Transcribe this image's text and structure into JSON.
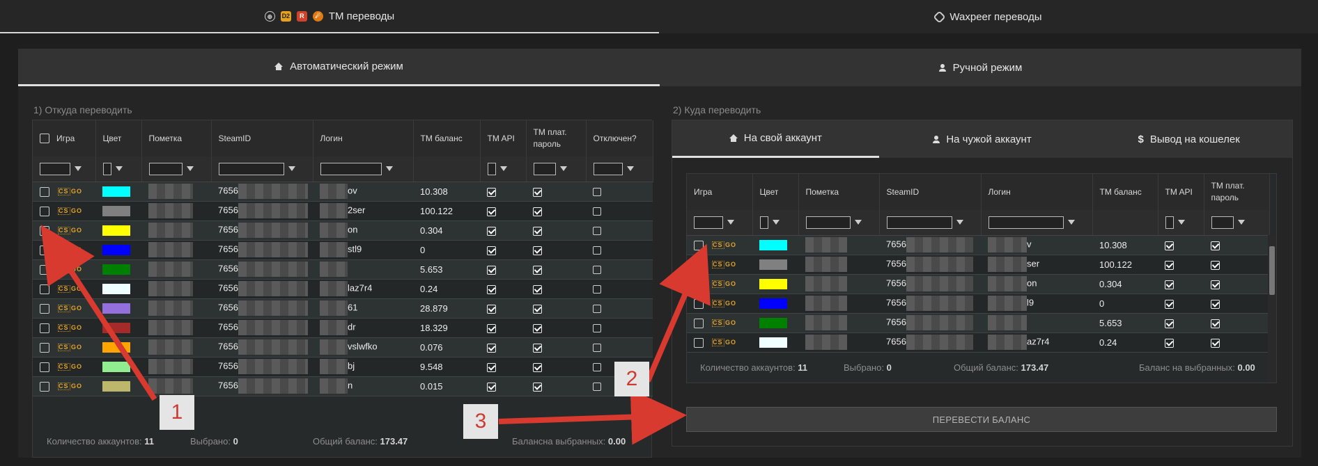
{
  "top_tabs": {
    "tm_label": "TM переводы",
    "waxpeer_label": "Waxpeer переводы",
    "tm_game_icons": [
      "⊕",
      "D2",
      "R",
      "☄"
    ]
  },
  "mode_tabs": {
    "auto_label": "Автоматический режим",
    "manual_label": "Ручной режим"
  },
  "source": {
    "title": "1) Откуда переводить",
    "columns": [
      "Игра",
      "Цвет",
      "Пометка",
      "SteamID",
      "Логин",
      "TM баланс",
      "TM API",
      "TM плат. пароль",
      "Отключен?"
    ],
    "rows": [
      {
        "game": "CS GO",
        "color": "#00ffff",
        "steamid": "7656",
        "login": "ov",
        "balance": "10.308"
      },
      {
        "game": "CS GO",
        "color": "#808080",
        "steamid": "7656",
        "login": "2ser",
        "balance": "100.122"
      },
      {
        "game": "CS GO",
        "color": "#ffff00",
        "steamid": "7656",
        "login": "on",
        "balance": "0.304"
      },
      {
        "game": "CS GO",
        "color": "#0000ff",
        "steamid": "7656",
        "login": "stl9",
        "balance": "0"
      },
      {
        "game": "CS GO",
        "color": "#008000",
        "steamid": "7656",
        "login": "",
        "balance": "5.653"
      },
      {
        "game": "CS GO",
        "color": "#f0ffff",
        "steamid": "7656",
        "login": "laz7r4",
        "balance": "0.24"
      },
      {
        "game": "CS GO",
        "color": "#9370db",
        "steamid": "7656",
        "login": "61",
        "balance": "28.879"
      },
      {
        "game": "CS GO",
        "color": "#a52a2a",
        "steamid": "7656",
        "login": "dr",
        "balance": "18.329"
      },
      {
        "game": "CS GO",
        "color": "#ffa500",
        "steamid": "7656",
        "login": "vslwfko",
        "balance": "0.076"
      },
      {
        "game": "CS GO",
        "color": "#90ee90",
        "steamid": "7656",
        "login": "bj",
        "balance": "9.548"
      },
      {
        "game": "CS GO",
        "color": "#bdb76b",
        "steamid": "7656",
        "login": "n",
        "balance": "0.015"
      }
    ],
    "footer": {
      "count_label": "Количество аккаунтов:",
      "count_value": "11",
      "selected_label": "Выбрано:",
      "selected_value": "0",
      "total_label": "Общий баланс:",
      "total_value": "173.47",
      "sel_balance_label": "Балансна выбранных:",
      "sel_balance_value": "0.00"
    }
  },
  "dest": {
    "title": "2) Куда переводить",
    "tabs": [
      "На свой аккаунт",
      "На чужой аккаунт",
      "Вывод на кошелек"
    ],
    "tab_icons": [
      "home-icon",
      "user-icon",
      "dollar-icon"
    ],
    "columns": [
      "Игра",
      "Цвет",
      "Пометка",
      "SteamID",
      "Логин",
      "TM баланс",
      "TM API",
      "TM плат. пароль"
    ],
    "rows": [
      {
        "game": "CS GO",
        "color": "#00ffff",
        "steamid": "7656",
        "login": "v",
        "balance": "10.308"
      },
      {
        "game": "CS GO",
        "color": "#808080",
        "steamid": "7656",
        "login": "ser",
        "balance": "100.122"
      },
      {
        "game": "CS GO",
        "color": "#ffff00",
        "steamid": "7656",
        "login": "on",
        "balance": "0.304"
      },
      {
        "game": "CS GO",
        "color": "#0000ff",
        "steamid": "7656",
        "login": "l9",
        "balance": "0"
      },
      {
        "game": "CS GO",
        "color": "#008000",
        "steamid": "7656",
        "login": "",
        "balance": "5.653"
      },
      {
        "game": "CS GO",
        "color": "#f0ffff",
        "steamid": "7656",
        "login": "az7r4",
        "balance": "0.24"
      }
    ],
    "footer": {
      "count_label": "Количество аккаунтов:",
      "count_value": "11",
      "selected_label": "Выбрано:",
      "selected_value": "0",
      "total_label": "Общий баланс:",
      "total_value": "173.47",
      "sel_balance_label": "Баланс на выбранных:",
      "sel_balance_value": "0.00"
    },
    "transfer_button": "ПЕРЕВЕСТИ БАЛАНС"
  },
  "annotations": [
    "1",
    "2",
    "3"
  ],
  "colors": {
    "arrow": "#d93a2f",
    "accent": "#e3a32a"
  }
}
